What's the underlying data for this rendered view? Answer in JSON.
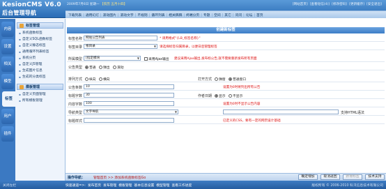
{
  "header": {
    "logo": "KesionCMS V6.0",
    "subtitle": "后台管理导航",
    "date": "2009年7月6日 星期一",
    "lunar": "【农历 五月十四】",
    "top_links": [
      "[网站首页]",
      "[查看短信(4)]",
      "[修改密码]",
      "[更新缓存]",
      "[安全退出]"
    ]
  },
  "nav_bar": [
    "下载列表",
    "通用幻灯",
    "滚动图片",
    "滚动文字",
    "不规则",
    "循环列表",
    "相关稿稿",
    "终端分页",
    "专题",
    "空间",
    "其它",
    "问问",
    "论坛",
    "首页"
  ],
  "tabs": [
    "内容",
    "设置",
    "相关",
    "模型",
    "标签",
    "用户",
    "插件"
  ],
  "sidebar": {
    "group1": {
      "title": "标签管理",
      "items": [
        "系统函数标签",
        "自定义SQL函数标签",
        "自定义静态标签",
        "通用循环列表标签",
        "系统分页",
        "自定义JS管理",
        "生成图片信息",
        "生成的分类标签"
      ]
    },
    "group2": {
      "title": "模板管理",
      "items": [
        "自定义页面管理",
        "所有模板管理"
      ]
    }
  },
  "form": {
    "title": "创建新标签",
    "tag_name_label": "标签名称",
    "tag_name_value": "网站公告列表",
    "tag_name_hint": "* 调用格式\"{LB_标签名称}\"",
    "tag_dir_label": "标签目录",
    "tag_dir_value": "根目录",
    "tag_dir_hint": "请选择标签归属目录，以便日后管理标签",
    "channel_label": "所属模型",
    "channel_value": "[指定模块",
    "ajax_label": "采用Ajax输出",
    "ajax_hint": "建议采用Ajax输出,发布标公告,就不需要重新发布所有页面",
    "type_label": "公告类型",
    "type_options": [
      "普通",
      "弹出",
      "滚动"
    ],
    "arrange_label": "排列方式",
    "arrange_options": [
      "纵向",
      "横向"
    ],
    "open_label": "打开方式",
    "open_options": [
      "弹窗",
      "普通窗口"
    ],
    "count_label": "公告条数",
    "count_value": "10",
    "count_hint": "设置为0时将列出所有公告",
    "title_len_label": "标题字数",
    "title_len_value": "30",
    "author_label": "作者日期",
    "author_options": [
      "显示",
      "不显示"
    ],
    "content_len_label": "内容字数",
    "content_len_value": "100",
    "content_len_hint": "设置为0时不显示公告内容",
    "nav_type_label": "导航类型",
    "nav_type_value": "文字导航",
    "nav_text_hint": "支持HTML语法",
    "style_label": "标题样式",
    "style_hint": "已定义的CSS，要有一定的网页设计基础"
  },
  "ops": {
    "label": "操作导航：",
    "crumb": "管理首页 >> 添加系统函数标签Go",
    "buttons": [
      "确定增加",
      "取消返回",
      "新增标签",
      "技术支持"
    ]
  },
  "footer": {
    "left": "关闭左栏",
    "links": [
      "快速通道=>:",
      "发布首页",
      "发布管理",
      "模板管理",
      "基本信息设置",
      "模型管理",
      "查看工作进度"
    ],
    "right": "版权所有 © 2006-2010 科汛信息技术有限公司"
  }
}
